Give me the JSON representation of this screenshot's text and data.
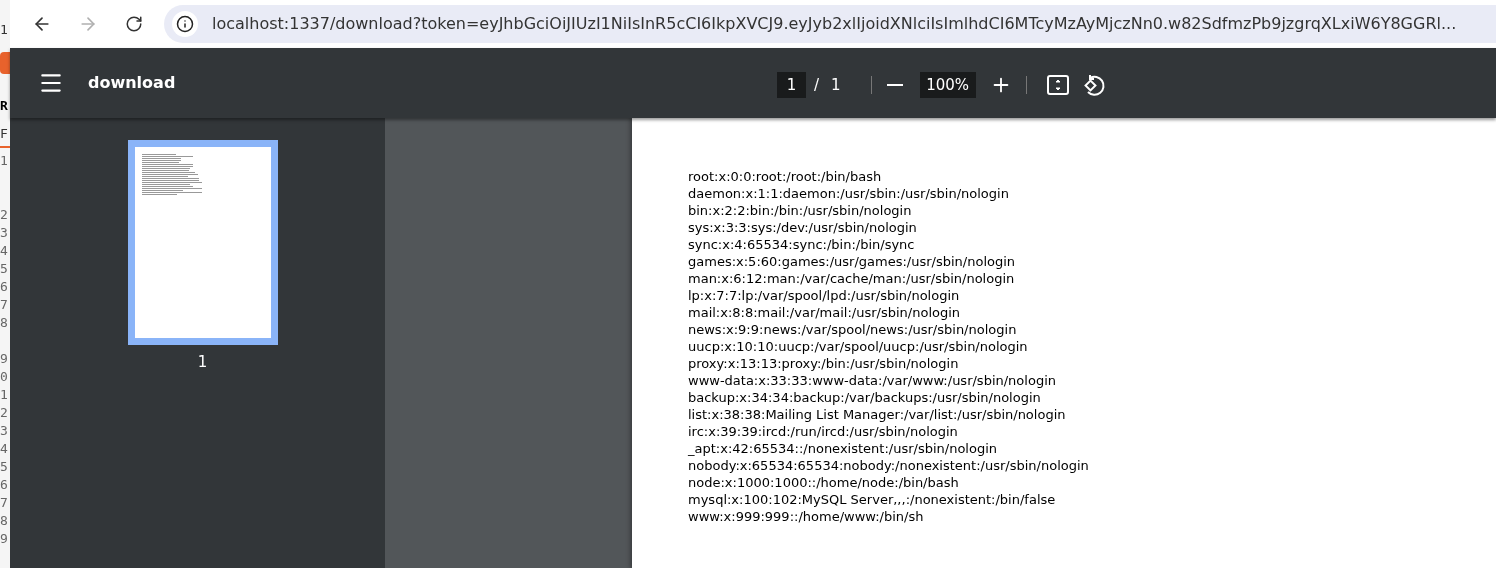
{
  "background_window": {
    "tab_label": "1",
    "heading": "R",
    "field_label": "F",
    "line_numbers": [
      "1",
      "2",
      "3",
      "4",
      "5",
      "6",
      "7",
      "8",
      "9",
      "0",
      "1",
      "2",
      "3",
      "4",
      "5",
      "6",
      "7",
      "8",
      "9"
    ]
  },
  "browser": {
    "nav_buttons": [
      {
        "kind": "back",
        "disabled": false
      },
      {
        "kind": "forward",
        "disabled": true
      },
      {
        "kind": "reload",
        "disabled": false
      }
    ],
    "url": "localhost:1337/download?token=eyJhbGciOiJIUzI1NiIsInR5cCI6IkpXVCJ9.eyJyb2xlIjoidXNlciIsImlhdCI6MTcyMzAyMjczNn0.w82SdfmzPb9jzgrqXLxiW6Y8GGRl..."
  },
  "pdf_viewer": {
    "title": "download",
    "current_page": "1",
    "page_separator": "/",
    "page_count": "1",
    "zoom": "100%",
    "thumbnails": [
      {
        "label": "1",
        "selected": true
      }
    ],
    "page_lines": [
      "root:x:0:0:root:/root:/bin/bash",
      "daemon:x:1:1:daemon:/usr/sbin:/usr/sbin/nologin",
      "bin:x:2:2:bin:/bin:/usr/sbin/nologin",
      "sys:x:3:3:sys:/dev:/usr/sbin/nologin",
      "sync:x:4:65534:sync:/bin:/bin/sync",
      "games:x:5:60:games:/usr/games:/usr/sbin/nologin",
      "man:x:6:12:man:/var/cache/man:/usr/sbin/nologin",
      "lp:x:7:7:lp:/var/spool/lpd:/usr/sbin/nologin",
      "mail:x:8:8:mail:/var/mail:/usr/sbin/nologin",
      "news:x:9:9:news:/var/spool/news:/usr/sbin/nologin",
      "uucp:x:10:10:uucp:/var/spool/uucp:/usr/sbin/nologin",
      "proxy:x:13:13:proxy:/bin:/usr/sbin/nologin",
      "www-data:x:33:33:www-data:/var/www:/usr/sbin/nologin",
      "backup:x:34:34:backup:/var/backups:/usr/sbin/nologin",
      "list:x:38:38:Mailing List Manager:/var/list:/usr/sbin/nologin",
      "irc:x:39:39:ircd:/run/ircd:/usr/sbin/nologin",
      "_apt:x:42:65534::/nonexistent:/usr/sbin/nologin",
      "nobody:x:65534:65534:nobody:/nonexistent:/usr/sbin/nologin",
      "node:x:1000:1000::/home/node:/bin/bash",
      "mysql:x:100:102:MySQL Server,,,:/nonexistent:/bin/false",
      "www:x:999:999::/home/www:/bin/sh"
    ]
  }
}
